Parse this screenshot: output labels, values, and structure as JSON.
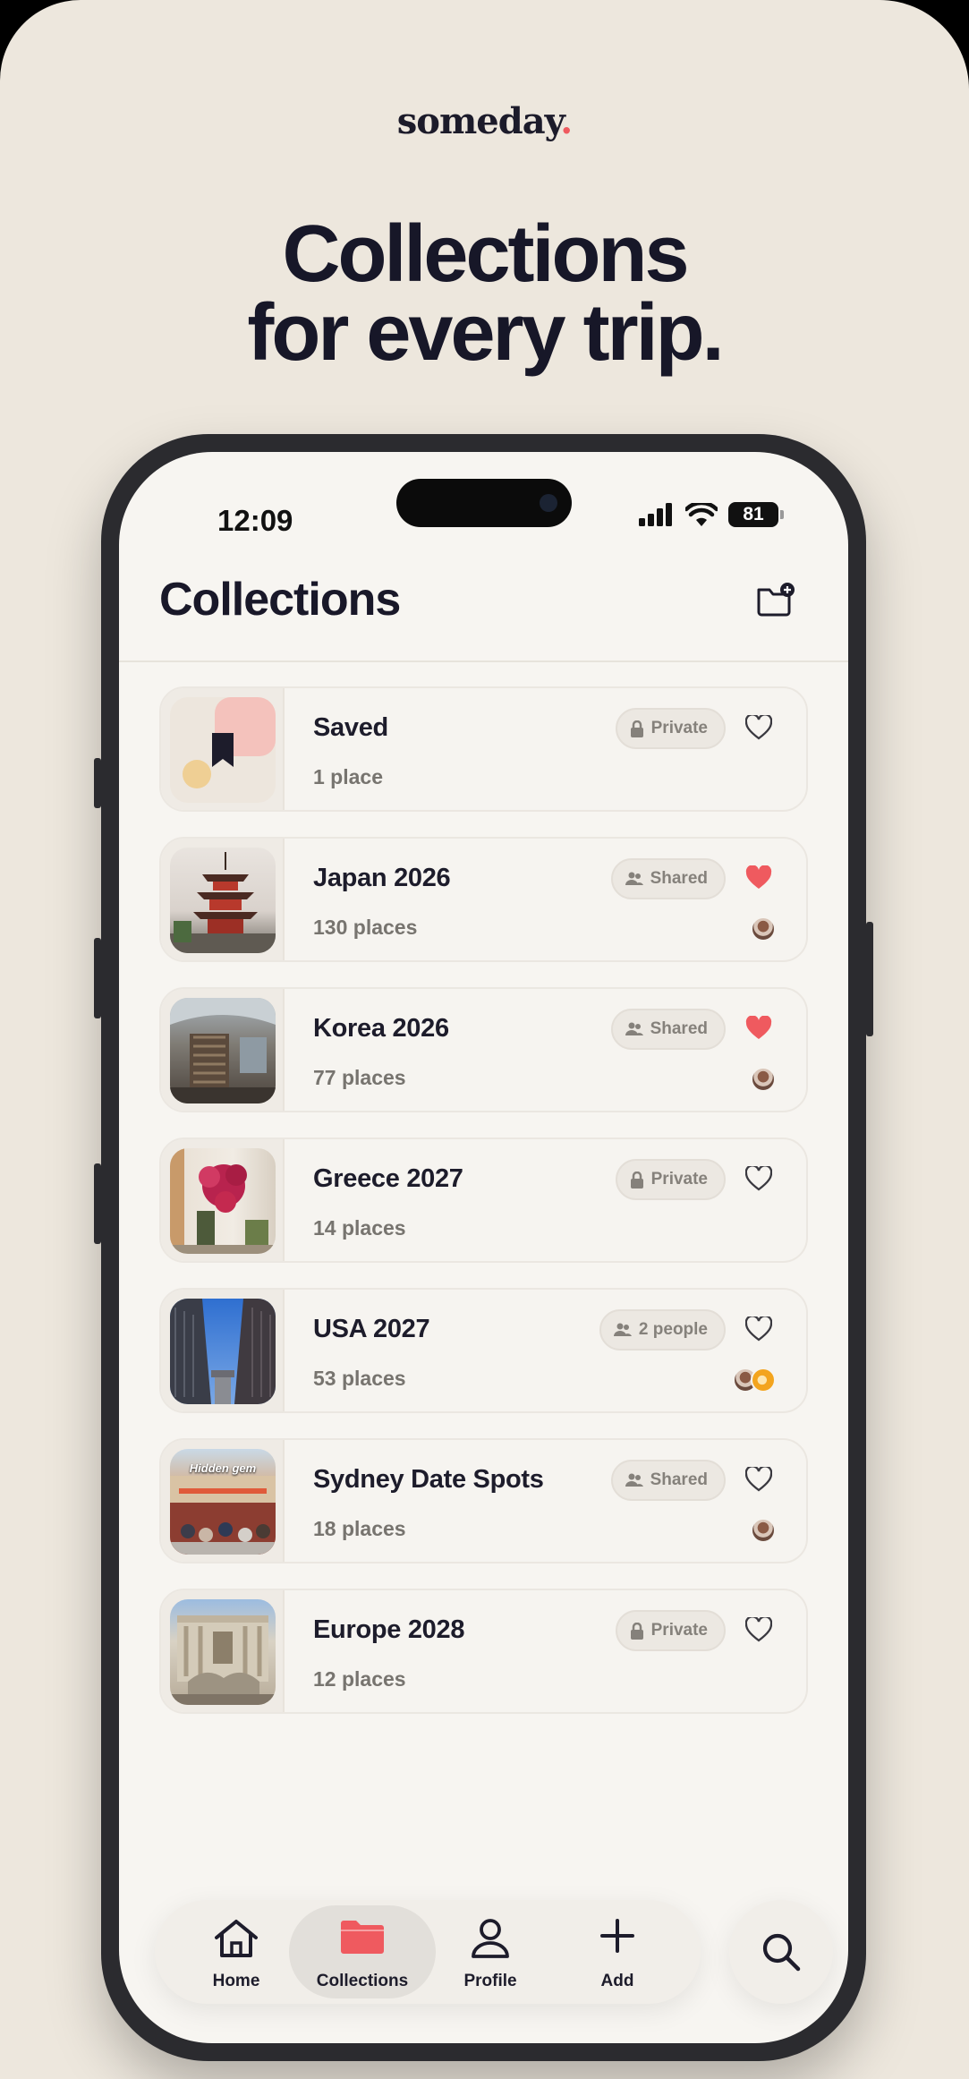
{
  "brand": {
    "name": "someday",
    "dot": "."
  },
  "headline": {
    "line1": "Collections",
    "line2": "for every trip."
  },
  "status_bar": {
    "time": "12:09",
    "battery": "81"
  },
  "header": {
    "title": "Collections",
    "action_icon": "folder-plus-icon"
  },
  "collections": [
    {
      "title": "Saved",
      "subtitle": "1 place",
      "badge": "Private",
      "badge_icon": "lock-icon",
      "favorited": false,
      "avatars": 0
    },
    {
      "title": "Japan 2026",
      "subtitle": "130 places",
      "badge": "Shared",
      "badge_icon": "people-icon",
      "favorited": true,
      "avatars": 1
    },
    {
      "title": "Korea 2026",
      "subtitle": "77 places",
      "badge": "Shared",
      "badge_icon": "people-icon",
      "favorited": true,
      "avatars": 1
    },
    {
      "title": "Greece 2027",
      "subtitle": "14 places",
      "badge": "Private",
      "badge_icon": "lock-icon",
      "favorited": false,
      "avatars": 0
    },
    {
      "title": "USA 2027",
      "subtitle": "53 places",
      "badge": "2 people",
      "badge_icon": "people-icon",
      "favorited": false,
      "avatars": 2
    },
    {
      "title": "Sydney Date Spots",
      "subtitle": "18 places",
      "badge": "Shared",
      "badge_icon": "people-icon",
      "favorited": false,
      "avatars": 1,
      "thumb_text": "Hidden gem"
    },
    {
      "title": "Europe 2028",
      "subtitle": "12 places",
      "badge": "Private",
      "badge_icon": "lock-icon",
      "favorited": false,
      "avatars": 0
    }
  ],
  "tabbar": {
    "home": "Home",
    "collections": "Collections",
    "profile": "Profile",
    "add": "Add",
    "active": "Collections"
  },
  "colors": {
    "accent": "#ef5a5f",
    "background": "#ede7dd",
    "screen": "#f7f5f1",
    "text": "#191829"
  }
}
